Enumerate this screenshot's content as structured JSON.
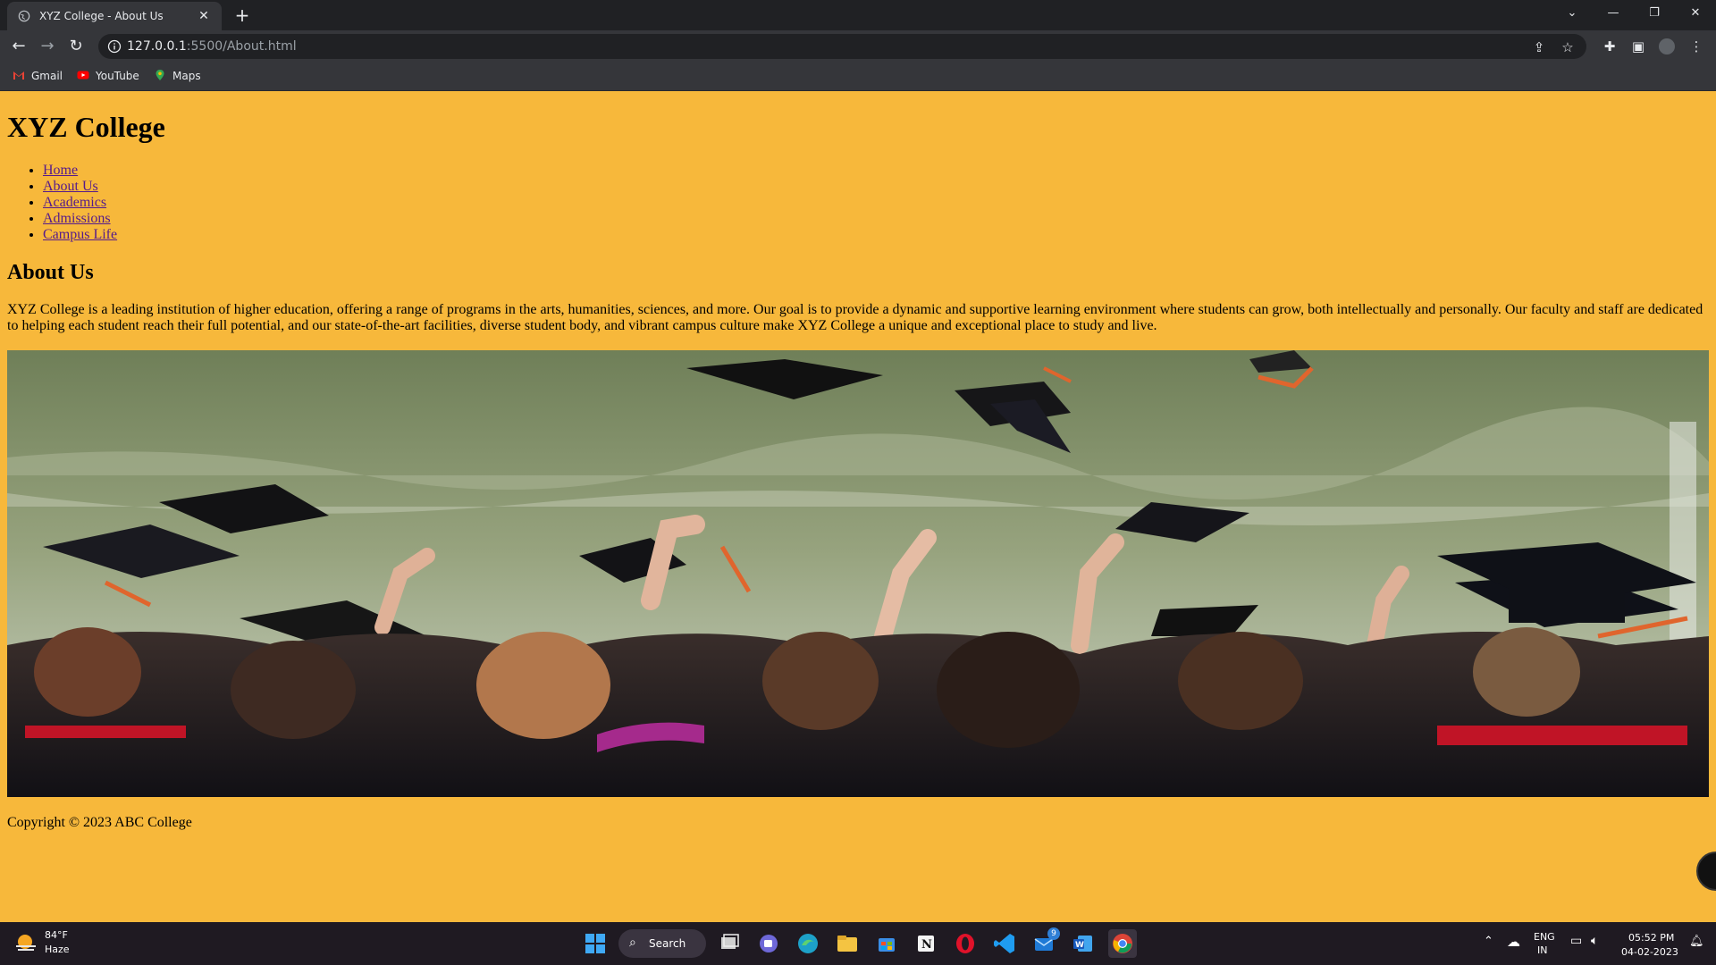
{
  "browser": {
    "tab_title": "XYZ College - About Us",
    "url_host": "127.0.0.1",
    "url_path": ":5500/About.html",
    "bookmarks": [
      "Gmail",
      "YouTube",
      "Maps"
    ]
  },
  "page": {
    "site_title": "XYZ College",
    "nav": [
      "Home",
      "About Us",
      "Academics",
      "Admissions",
      "Campus Life"
    ],
    "section_title": "About Us",
    "paragraph": "XYZ College is a leading institution of higher education, offering a range of programs in the arts, humanities, sciences, and more. Our goal is to provide a dynamic and supportive learning environment where students can grow, both intellectually and personally. Our faculty and staff are dedicated to helping each student reach their full potential, and our state-of-the-art facilities, diverse student body, and vibrant campus culture make XYZ College a unique and exceptional place to study and live.",
    "footer": "Copyright © 2023 ABC College",
    "background_color": "#f7b83b"
  },
  "taskbar": {
    "weather_temp": "84°F",
    "weather_cond": "Haze",
    "search_label": "Search",
    "lang_top": "ENG",
    "lang_bottom": "IN",
    "time": "05:52 PM",
    "date": "04-02-2023",
    "badge_count": "9"
  }
}
